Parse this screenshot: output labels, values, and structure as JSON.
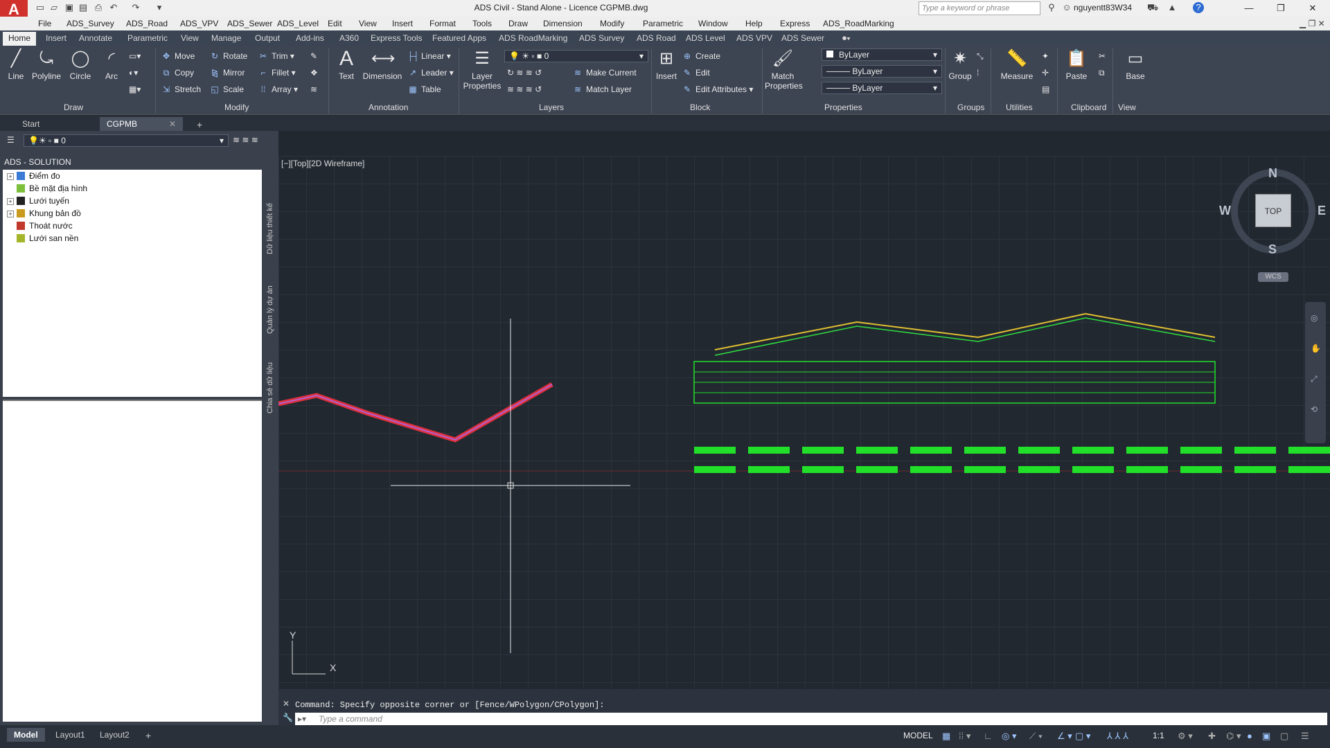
{
  "titlebar": {
    "app_logo": "A",
    "title": "ADS Civil - Stand Alone - Licence    CGPMB.dwg",
    "search_placeholder": "Type a keyword or phrase",
    "user": "nguyentt83W34"
  },
  "menubar": [
    "File",
    "ADS_Survey",
    "ADS_Road",
    "ADS_VPV",
    "ADS_Sewer",
    "ADS_Level",
    "Edit",
    "View",
    "Insert",
    "Format",
    "Tools",
    "Draw",
    "Dimension",
    "Modify",
    "Parametric",
    "Window",
    "Help",
    "Express",
    "ADS_RoadMarking"
  ],
  "ribbon_tabs": [
    "Home",
    "Insert",
    "Annotate",
    "Parametric",
    "View",
    "Manage",
    "Output",
    "Add-ins",
    "A360",
    "Express Tools",
    "Featured Apps",
    "ADS RoadMarking",
    "ADS Survey",
    "ADS Road",
    "ADS Level",
    "ADS VPV",
    "ADS Sewer"
  ],
  "ribbon": {
    "draw": {
      "line": "Line",
      "polyline": "Polyline",
      "circle": "Circle",
      "arc": "Arc",
      "title": "Draw"
    },
    "modify": {
      "move": "Move",
      "rotate": "Rotate",
      "trim": "Trim",
      "copy": "Copy",
      "mirror": "Mirror",
      "fillet": "Fillet",
      "stretch": "Stretch",
      "scale": "Scale",
      "array": "Array",
      "title": "Modify"
    },
    "annotation": {
      "text": "Text",
      "dimension": "Dimension",
      "linear": "Linear",
      "leader": "Leader",
      "table": "Table",
      "title": "Annotation"
    },
    "layers": {
      "layer_properties_1": "Layer",
      "layer_properties_2": "Properties",
      "current_layer": "0",
      "make_current": "Make Current",
      "match_layer": "Match Layer",
      "title": "Layers"
    },
    "block": {
      "insert": "Insert",
      "create": "Create",
      "edit": "Edit",
      "edit_attributes": "Edit Attributes",
      "title": "Block"
    },
    "properties": {
      "match_1": "Match",
      "match_2": "Properties",
      "color": "ByLayer",
      "linetype": "ByLayer",
      "lineweight": "ByLayer",
      "title": "Properties"
    },
    "groups": {
      "group": "Group",
      "title": "Groups"
    },
    "utilities": {
      "measure": "Measure",
      "title": "Utilities"
    },
    "clipboard": {
      "paste": "Paste",
      "title": "Clipboard"
    },
    "view": {
      "base": "Base",
      "title": "View"
    }
  },
  "doc_tabs": [
    "Start",
    "CGPMB"
  ],
  "layer_bar": {
    "current": "0"
  },
  "left_panel": {
    "title": "ADS - SOLUTION",
    "tree": [
      {
        "label": "Điểm đo",
        "color": "#3b7bd6",
        "expandable": true
      },
      {
        "label": "Bề mặt địa hình",
        "color": "#7cbf3a",
        "expandable": false
      },
      {
        "label": "Lưới tuyến",
        "color": "#222222",
        "expandable": true
      },
      {
        "label": "Khung bản đồ",
        "color": "#c89a1e",
        "expandable": true
      },
      {
        "label": "Thoát nước",
        "color": "#c0392b",
        "expandable": false
      },
      {
        "label": "Lưới san nền",
        "color": "#a5b52a",
        "expandable": false
      }
    ],
    "vertical_tabs": [
      "Dữ liệu thiết kế",
      "Quản lý dự án",
      "Chia sẻ dữ liệu"
    ]
  },
  "viewport": {
    "label": "[−][Top][2D Wireframe]",
    "compass": {
      "n": "N",
      "s": "S",
      "e": "E",
      "w": "W",
      "top": "TOP"
    },
    "wcs": "WCS"
  },
  "command": {
    "history": "Command: Specify opposite corner or [Fence/WPolygon/CPolygon]:",
    "placeholder": "Type a command"
  },
  "statusbar": {
    "layout_tabs": [
      "Model",
      "Layout1",
      "Layout2"
    ],
    "model_label": "MODEL",
    "scale": "1:1"
  },
  "colors": {
    "ribbon": "#3d4452",
    "canvas": "#212830",
    "accent": "#d0312d",
    "drawing_green": "#22e02a",
    "drawing_red": "#e0303a"
  }
}
